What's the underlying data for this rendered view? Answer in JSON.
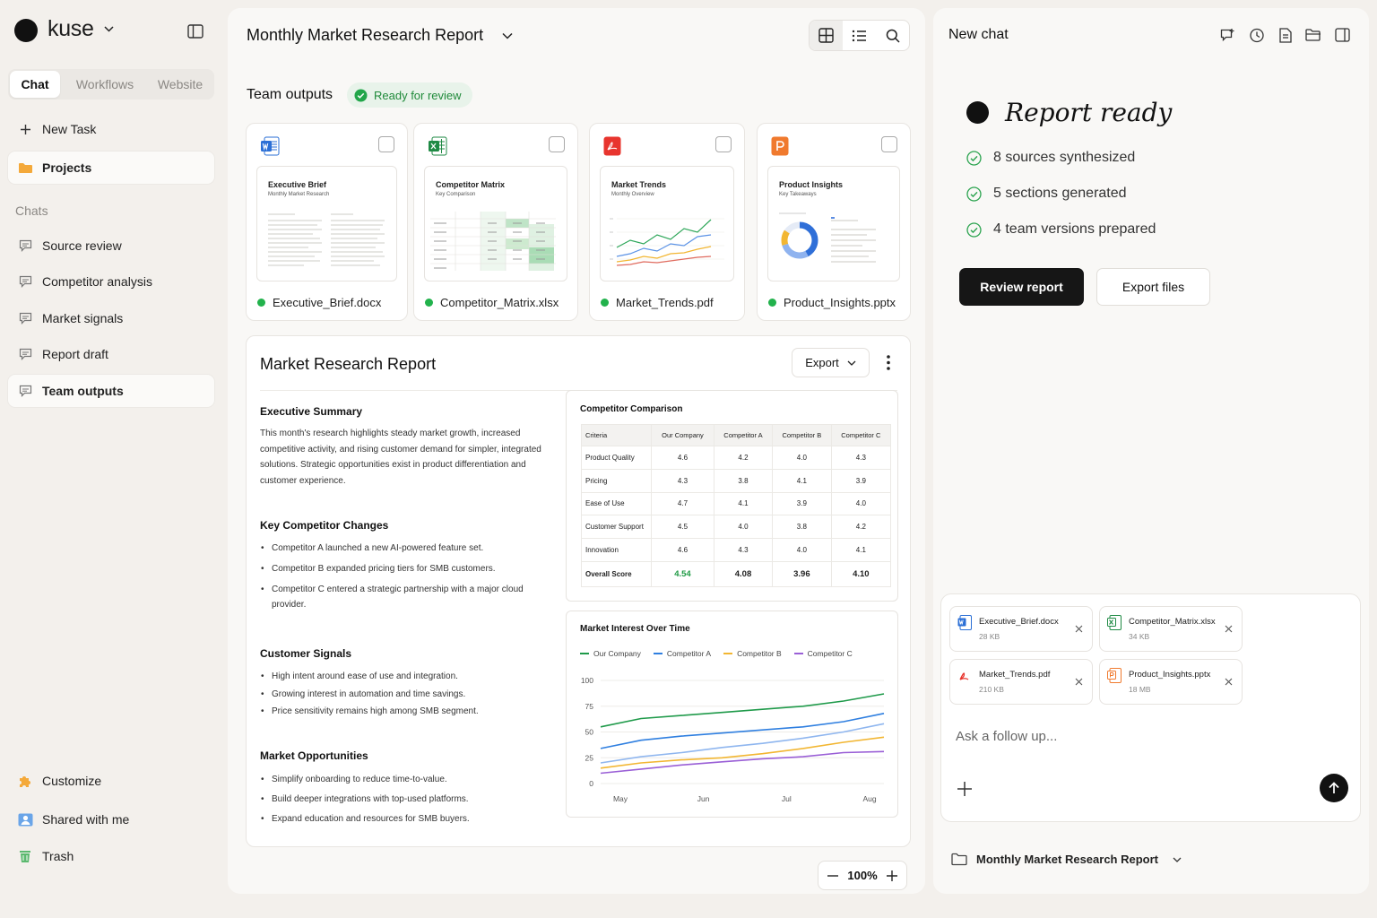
{
  "sidebar": {
    "brand": "kuse",
    "tabs": [
      "Chat",
      "Workflows",
      "Website"
    ],
    "new_task": "New Task",
    "projects": "Projects",
    "chats_heading": "Chats",
    "chats": [
      "Source review",
      "Competitor analysis",
      "Market signals",
      "Report draft",
      "Team outputs"
    ],
    "bottom": [
      "Customize",
      "Shared with me",
      "Trash"
    ]
  },
  "header": {
    "title": "Monthly Market Research Report"
  },
  "team_outputs": {
    "title": "Team outputs",
    "badge": "Ready for review",
    "files": [
      {
        "name": "Executive_Brief.docx",
        "thumb_title": "Executive Brief",
        "thumb_sub": "Monthly Market Research",
        "icon": "word-icon"
      },
      {
        "name": "Competitor_Matrix.xlsx",
        "thumb_title": "Competitor Matrix",
        "thumb_sub": "Key Comparison",
        "icon": "excel-icon"
      },
      {
        "name": "Market_Trends.pdf",
        "thumb_title": "Market Trends",
        "thumb_sub": "Monthly Overview",
        "icon": "pdf-icon"
      },
      {
        "name": "Product_Insights.pptx",
        "thumb_title": "Product Insights",
        "thumb_sub": "Key Takeaways",
        "icon": "powerpoint-icon"
      }
    ]
  },
  "report": {
    "title": "Market Research Report",
    "export_label": "Export",
    "exec_summary_title": "Executive Summary",
    "exec_summary": "This month's research highlights steady market growth, increased competitive activity, and rising customer demand for simpler, integrated solutions. Strategic opportunities exist in product differentiation and customer experience.",
    "competitor_changes_title": "Key Competitor Changes",
    "competitor_changes": [
      "Competitor A launched a new AI-powered feature set.",
      "Competitor B expanded pricing tiers for SMB customers.",
      "Competitor C entered a strategic partnership with a major cloud provider."
    ],
    "customer_signals_title": "Customer Signals",
    "customer_signals": [
      "High intent around ease of use and integration.",
      "Growing interest in automation and time savings.",
      "Price sensitivity remains high among SMB segment."
    ],
    "opportunities_title": "Market Opportunities",
    "opportunities": [
      "Simplify onboarding to reduce time-to-value.",
      "Build deeper integrations with top-used platforms.",
      "Expand education and resources for SMB buyers."
    ],
    "comparison": {
      "title": "Competitor Comparison",
      "headers": [
        "Criteria",
        "Our Company",
        "Competitor A",
        "Competitor B",
        "Competitor C"
      ],
      "rows": [
        [
          "Product Quality",
          "4.6",
          "4.2",
          "4.0",
          "4.3"
        ],
        [
          "Pricing",
          "4.3",
          "3.8",
          "4.1",
          "3.9"
        ],
        [
          "Ease of Use",
          "4.7",
          "4.1",
          "3.9",
          "4.0"
        ],
        [
          "Customer Support",
          "4.5",
          "4.0",
          "3.8",
          "4.2"
        ],
        [
          "Innovation",
          "4.6",
          "4.3",
          "4.0",
          "4.1"
        ]
      ],
      "total": [
        "Overall Score",
        "4.54",
        "4.08",
        "3.96",
        "4.10"
      ],
      "highlight_color": "#1f9a44"
    },
    "zoom": "100%"
  },
  "chart_data": {
    "type": "line",
    "title": "Market Interest Over Time",
    "categories": [
      "May",
      "Jun",
      "Jul",
      "Aug"
    ],
    "ylim": [
      0,
      100
    ],
    "yticks": [
      "0",
      "25",
      "50",
      "75",
      "100"
    ],
    "legend_position": "top",
    "x": [
      0,
      0.5,
      1,
      1.5,
      2,
      2.5,
      3,
      3.5
    ],
    "series": [
      {
        "name": "Our Company",
        "color": "#1f9a4a",
        "values": [
          55,
          63,
          66,
          69,
          72,
          75,
          80,
          87
        ]
      },
      {
        "name": "Competitor A",
        "color": "#2f7fe0",
        "values": [
          34,
          42,
          46,
          49,
          52,
          55,
          60,
          68
        ]
      },
      {
        "name": "Competitor B",
        "color": "#f2b632",
        "values": [
          15,
          20,
          23,
          25,
          29,
          34,
          40,
          45
        ]
      },
      {
        "name": "Competitor C",
        "color": "#9a5fd6",
        "values": [
          10,
          14,
          18,
          21,
          24,
          26,
          30,
          31
        ]
      }
    ],
    "extra_line": {
      "color": "#8fb6ef",
      "values": [
        20,
        26,
        30,
        35,
        39,
        44,
        50,
        58
      ]
    }
  },
  "right": {
    "title": "New chat",
    "status_title": "Report ready",
    "items": [
      "8 sources synthesized",
      "5 sections generated",
      "4 team versions prepared"
    ],
    "review_btn": "Review report",
    "export_btn": "Export files",
    "attachments": [
      {
        "name": "Executive_Brief.docx",
        "size": "28 KB",
        "icon": "word-icon"
      },
      {
        "name": "Competitor_Matrix.xlsx",
        "size": "34 KB",
        "icon": "excel-icon"
      },
      {
        "name": "Market_Trends.pdf",
        "size": "210 KB",
        "icon": "pdf-icon"
      },
      {
        "name": "Product_Insights.pptx",
        "size": "18 MB",
        "icon": "powerpoint-icon"
      }
    ],
    "placeholder": "Ask a follow up...",
    "project": "Monthly Market Research Report"
  }
}
